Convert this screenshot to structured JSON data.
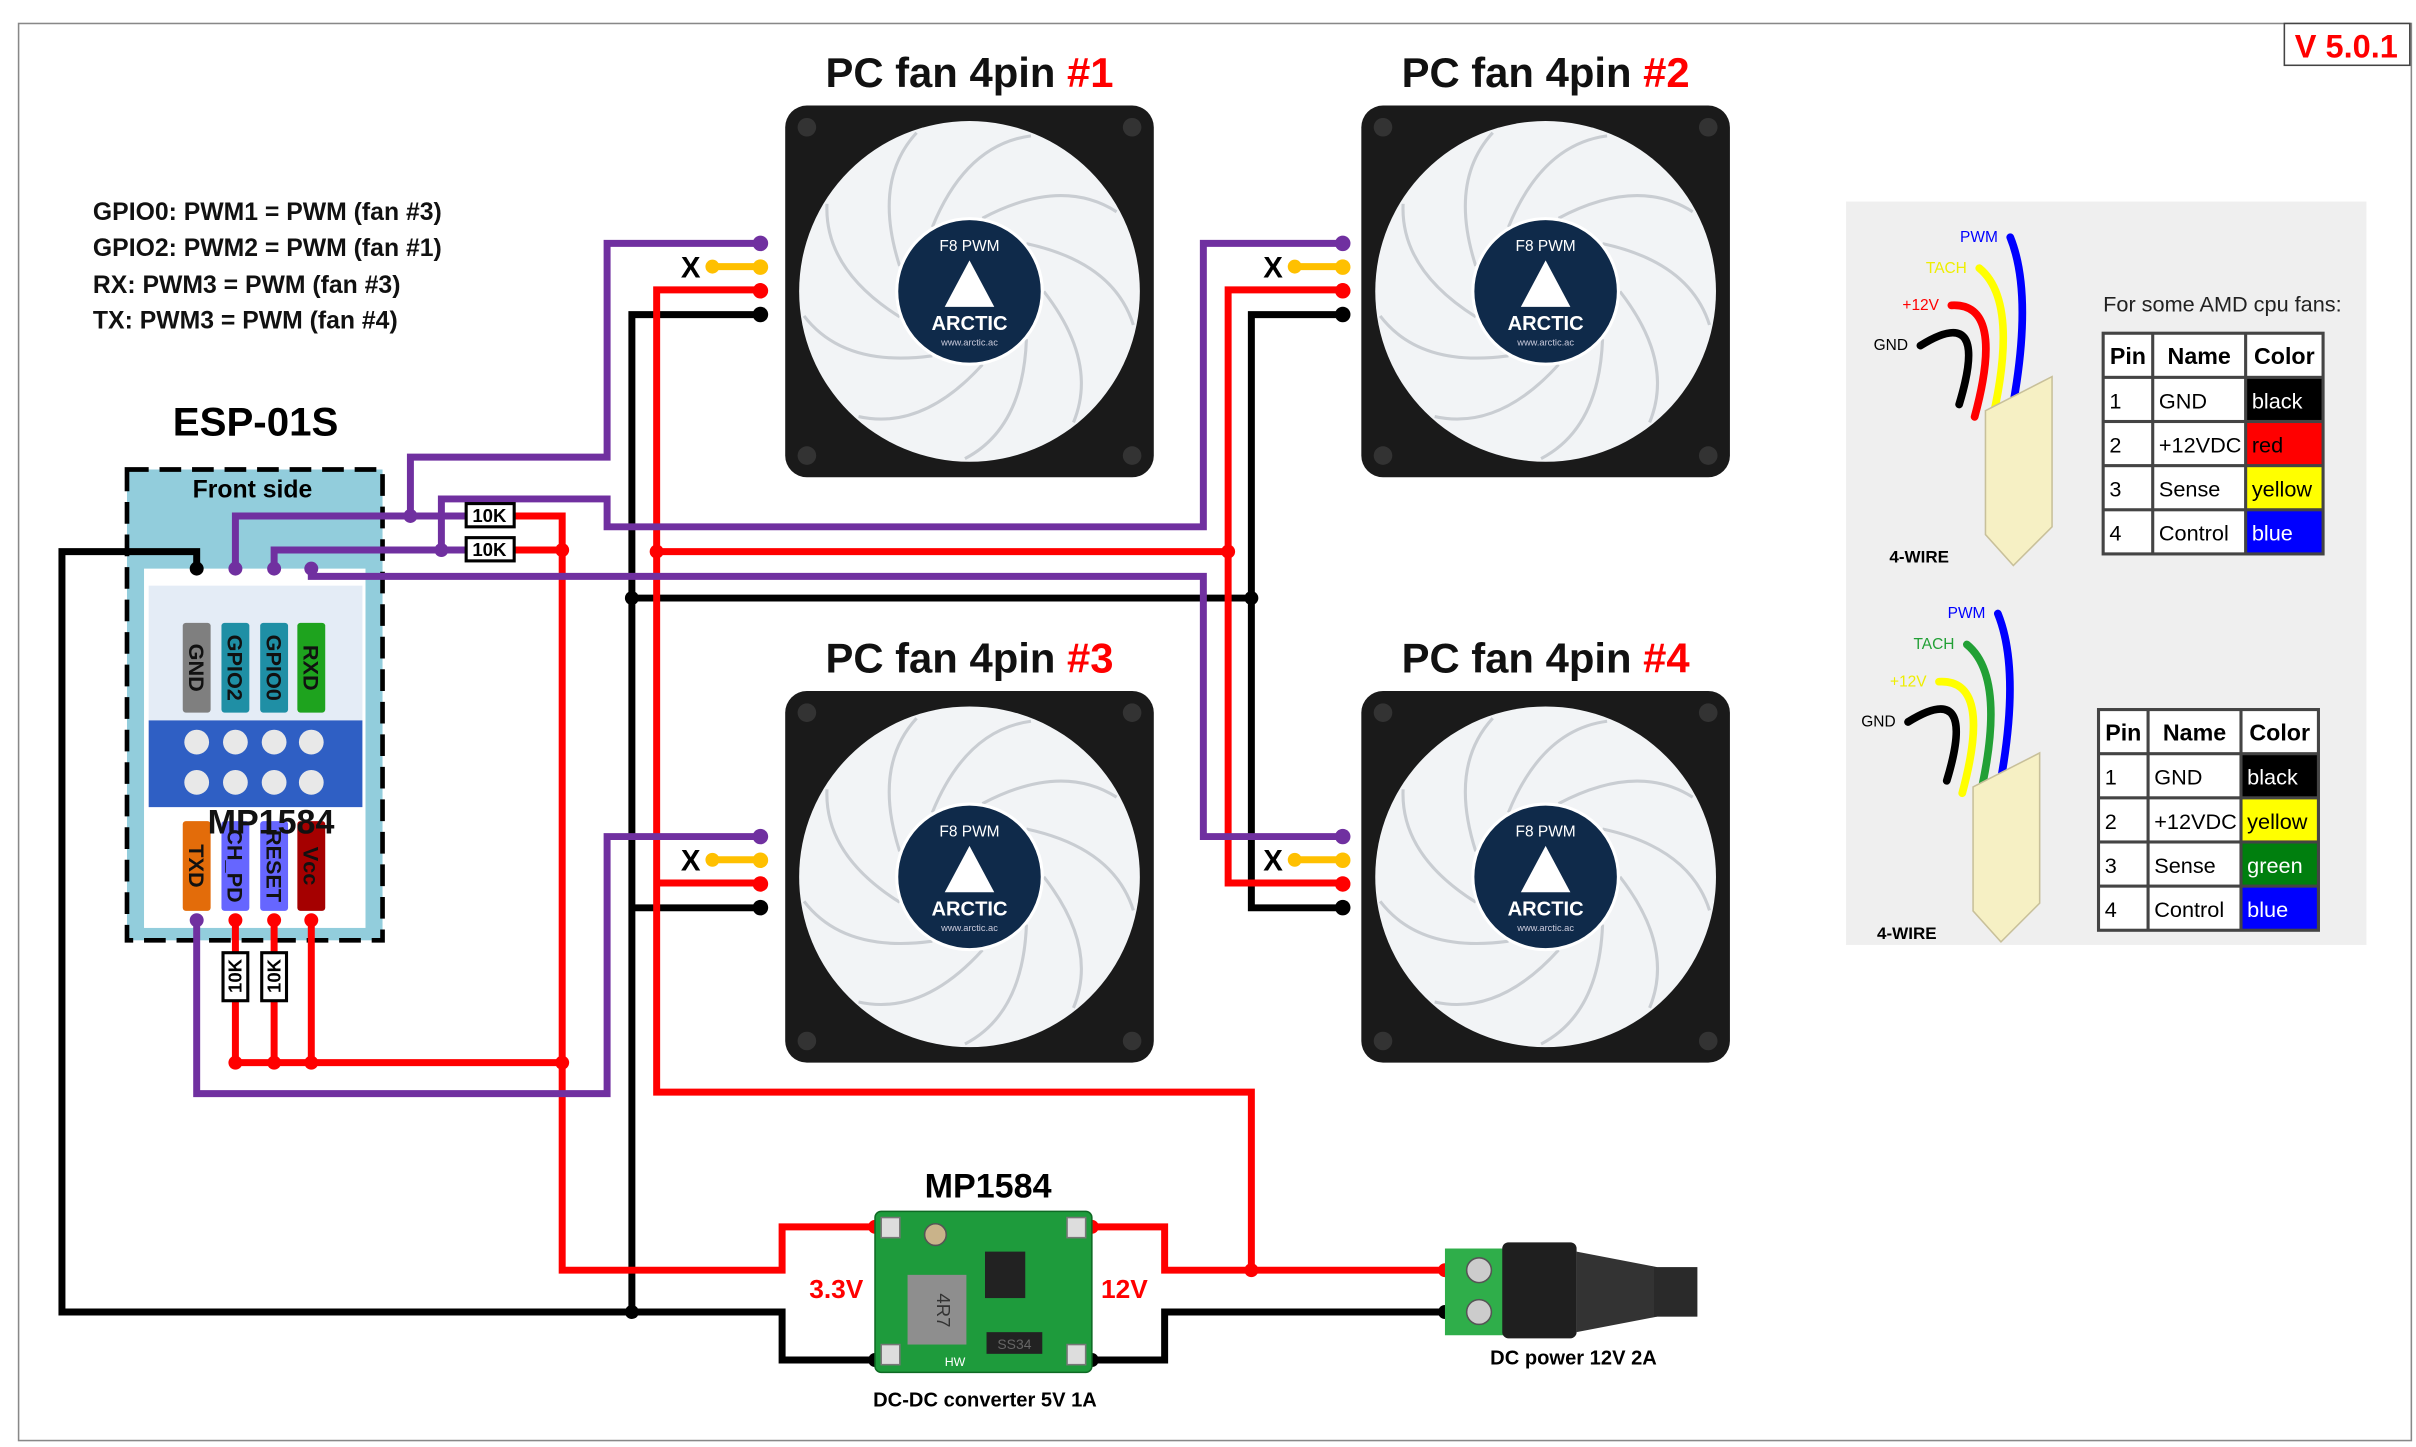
{
  "version": "V 5.0.1",
  "notes": [
    "GPIO0: PWM1 = PWM (fan #3)",
    "GPIO2: PWM2 = PWM (fan #1)",
    "RX: PWM3 = PWM (fan #3)",
    "TX: PWM3 = PWM (fan #4)"
  ],
  "esp": {
    "title": "ESP-01S",
    "front_side": "Front side",
    "overlay_label": "MP1584",
    "top_pins": [
      {
        "label": "GND",
        "color": "#7F7F7F"
      },
      {
        "label": "GPIO2",
        "color": "#1F8FA5"
      },
      {
        "label": "GPIO0",
        "color": "#1F8FA5"
      },
      {
        "label": "RXD",
        "color": "#1EA31E"
      }
    ],
    "bottom_pins": [
      {
        "label": "TXD",
        "color": "#E36C0A"
      },
      {
        "label": "CH_PD",
        "color": "#6666FF"
      },
      {
        "label": "RESET",
        "color": "#6666FF"
      },
      {
        "label": "Vcc",
        "color": "#A50000"
      }
    ]
  },
  "resistors": [
    "10K",
    "10K",
    "10K",
    "10K"
  ],
  "fans": [
    {
      "title": "PC fan 4pin ",
      "num": "#1",
      "hub_top": "F8 PWM",
      "brand": "ARCTIC",
      "url": "www.arctic.ac",
      "unused_mark": "X"
    },
    {
      "title": "PC fan 4pin ",
      "num": "#2",
      "hub_top": "F8 PWM",
      "brand": "ARCTIC",
      "url": "www.arctic.ac",
      "unused_mark": "X"
    },
    {
      "title": "PC fan 4pin ",
      "num": "#3",
      "hub_top": "F8 PWM",
      "brand": "ARCTIC",
      "url": "www.arctic.ac",
      "unused_mark": "X"
    },
    {
      "title": "PC fan 4pin ",
      "num": "#4",
      "hub_top": "F8 PWM",
      "brand": "ARCTIC",
      "url": "www.arctic.ac",
      "unused_mark": "X"
    }
  ],
  "converter": {
    "title": "MP1584",
    "caption": "DC-DC converter  5V 1A",
    "out_label": "3.3V",
    "in_label": "12V",
    "inductor": "4R7",
    "diode": "SS34",
    "silk": "HW"
  },
  "dc_jack": {
    "caption": "DC power  12V 2A"
  },
  "pinout": {
    "amd_note": "For some AMD cpu fans:",
    "connector_label": "4-WIRE",
    "headers": [
      "Pin",
      "Name",
      "Color"
    ],
    "standard": {
      "wires": [
        {
          "label": "PWM",
          "color": "#0000FF"
        },
        {
          "label": "TACH",
          "color": "#FFFF00"
        },
        {
          "label": "+12V",
          "color": "#FF0000"
        },
        {
          "label": "GND",
          "color": "#000000"
        }
      ],
      "rows": [
        [
          "1",
          "GND",
          "black",
          "#000000",
          "#FFFFFF"
        ],
        [
          "2",
          "+12VDC",
          "red",
          "#FF0000",
          "#000000"
        ],
        [
          "3",
          "Sense",
          "yellow",
          "#FFFF00",
          "#000000"
        ],
        [
          "4",
          "Control",
          "blue",
          "#0000FF",
          "#FFFFFF"
        ]
      ]
    },
    "amd": {
      "wires": [
        {
          "label": "PWM",
          "color": "#0000FF"
        },
        {
          "label": "TACH",
          "color": "#22A035"
        },
        {
          "label": "+12V",
          "color": "#FFFF00"
        },
        {
          "label": "GND",
          "color": "#000000"
        }
      ],
      "rows": [
        [
          "1",
          "GND",
          "black",
          "#000000",
          "#FFFFFF"
        ],
        [
          "2",
          "+12VDC",
          "yellow",
          "#FFFF00",
          "#000000"
        ],
        [
          "3",
          "Sense",
          "green",
          "#007F0E",
          "#FFFFFF"
        ],
        [
          "4",
          "Control",
          "blue",
          "#0000FF",
          "#FFFFFF"
        ]
      ]
    }
  },
  "colors": {
    "pwm": "#7030A0",
    "v12": "#FF0000",
    "gnd": "#000000",
    "tach": "#FFC000",
    "accent": "#FF0000"
  }
}
